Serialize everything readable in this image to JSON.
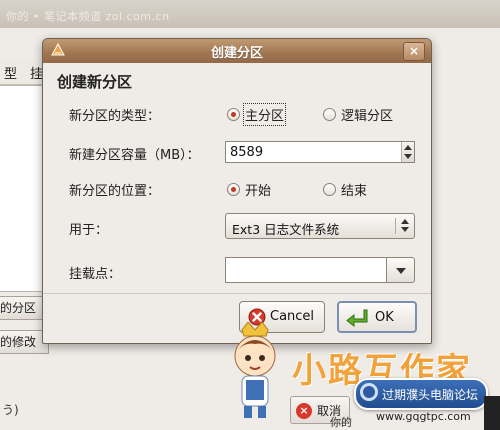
{
  "background": {
    "watermark": "你的 • 笔记本频道 zol.com.cn",
    "tabs": [
      "型",
      "挂"
    ],
    "side_buttons": [
      "的分区",
      "的修改"
    ],
    "status_text": "う)",
    "bottom_button": "取消",
    "bottom_label": "你的"
  },
  "dialog": {
    "title": "创建分区",
    "close_label": "×",
    "heading": "创建新分区",
    "type_label": "新分区的类型：",
    "type_options": [
      "主分区",
      "逻辑分区"
    ],
    "size_label": "新建分区容量（MB）：",
    "size_value": "8589",
    "position_label": "新分区的位置：",
    "position_options": [
      "开始",
      "结束"
    ],
    "use_label": "用于：",
    "filesystem": "Ext3 日志文件系统",
    "mount_label": "挂载点：",
    "mount_value": "",
    "cancel_label": "Cancel",
    "ok_label": "OK"
  },
  "decorations": {
    "brand": "小路互作家",
    "forum_badge": "过期濮头电脑论坛",
    "forum_url": "www.gqgtpc.com"
  },
  "colors": {
    "titlebar": "#a47a53",
    "radio_selected": "#c0392b",
    "cancel_icon": "#d8372c",
    "ok_icon": "#5fae2e",
    "brand": "#f2a23a"
  }
}
